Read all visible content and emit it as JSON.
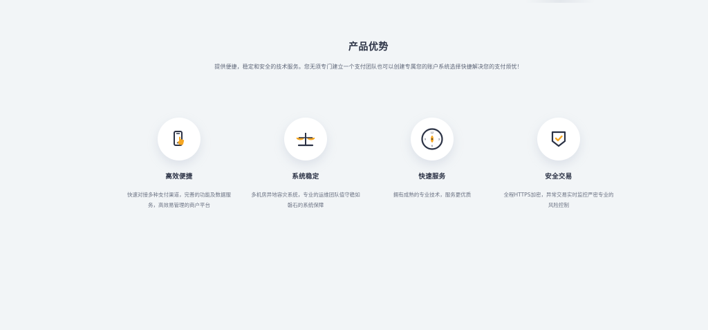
{
  "advantages": {
    "title": "产品优势",
    "subtitle": "提供便捷，稳定和安全的技术服务。您无须专门建立一个支付团队也可以创建专属您的账户系统选择快捷解决您的支付烦忧！",
    "items": [
      {
        "title": "高效便捷",
        "description": "快速对接多种支付渠道，完善的功能及数据服务，高效易管理的商户平台",
        "icon": "mobile-touch-icon"
      },
      {
        "title": "系统稳定",
        "description": "多机房异地容灾系统，专业的运维团队值守稳如磐石的系统保障",
        "icon": "balance-scale-icon"
      },
      {
        "title": "快速服务",
        "description": "拥有成熟的专业技术，服务更优质",
        "icon": "clock-icon"
      },
      {
        "title": "安全交易",
        "description": "全程HTTPS加密，异常交易实时监控严密专业的风险控制",
        "icon": "shield-check-icon"
      }
    ]
  },
  "colors": {
    "background": "#f2f5f7",
    "icon_dark": "#2b3245",
    "icon_accent": "#f5a623",
    "text_primary": "#2b3245",
    "text_secondary": "#6b7283"
  }
}
